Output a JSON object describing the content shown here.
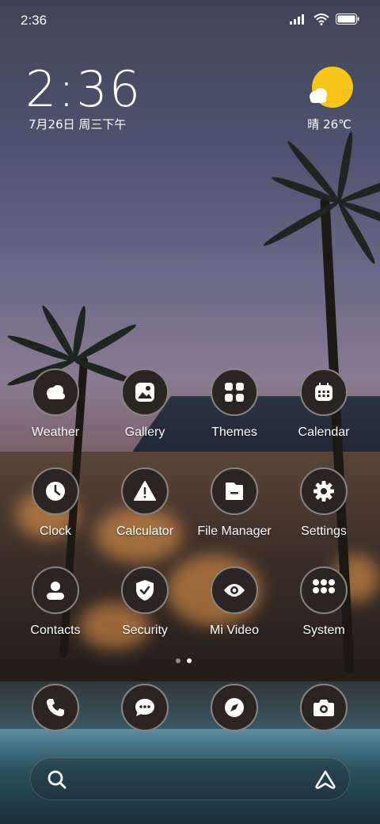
{
  "status_bar": {
    "time": "2:36"
  },
  "clock_widget": {
    "time": "2:36",
    "date": "7月26日 周三下午"
  },
  "weather_widget": {
    "condition": "晴",
    "temperature": "26℃",
    "sun_color": "#f5c518"
  },
  "apps": [
    {
      "label": "Weather",
      "icon": "weather-icon"
    },
    {
      "label": "Gallery",
      "icon": "gallery-icon"
    },
    {
      "label": "Themes",
      "icon": "themes-icon"
    },
    {
      "label": "Calendar",
      "icon": "calendar-icon"
    },
    {
      "label": "Clock",
      "icon": "clock-icon"
    },
    {
      "label": "Calculator",
      "icon": "calculator-icon"
    },
    {
      "label": "File Manager",
      "icon": "file-manager-icon"
    },
    {
      "label": "Settings",
      "icon": "gear-icon"
    },
    {
      "label": "Contacts",
      "icon": "contacts-icon"
    },
    {
      "label": "Security",
      "icon": "shield-icon"
    },
    {
      "label": "Mi Video",
      "icon": "eye-icon"
    },
    {
      "label": "System",
      "icon": "folder-icon"
    }
  ],
  "dock": [
    {
      "icon": "phone-icon"
    },
    {
      "icon": "messages-icon"
    },
    {
      "icon": "compass-icon"
    },
    {
      "icon": "camera-icon"
    }
  ],
  "page_indicator": {
    "pages": 2,
    "active": 2
  },
  "search_bar": {
    "left_icon": "search-icon",
    "right_icon": "assistant-icon"
  }
}
